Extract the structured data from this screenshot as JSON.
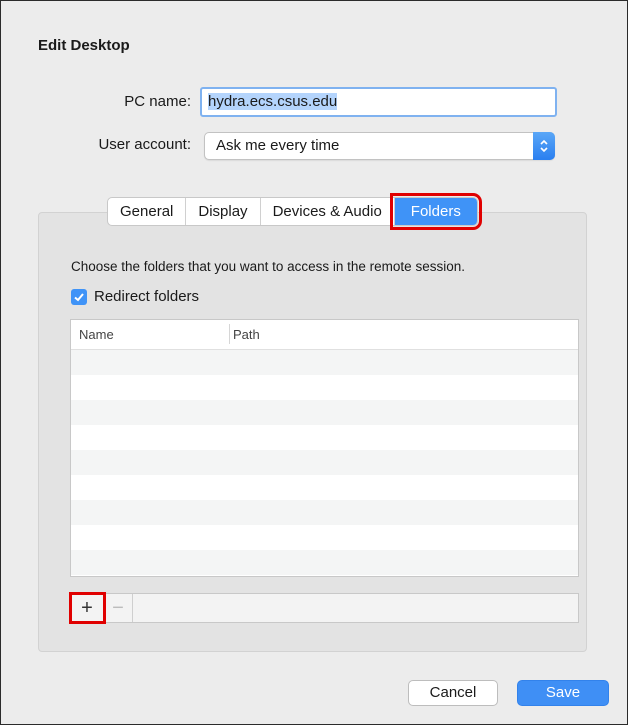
{
  "dialog": {
    "title": "Edit Desktop",
    "pc_name_label": "PC name:",
    "pc_name_value": "hydra.ecs.csus.edu",
    "user_account_label": "User account:",
    "user_account_value": "Ask me every time"
  },
  "tabs": [
    {
      "label": "General"
    },
    {
      "label": "Display"
    },
    {
      "label": "Devices & Audio"
    },
    {
      "label": "Folders",
      "active": true
    }
  ],
  "folders": {
    "description": "Choose the folders that you want to access in the remote session.",
    "redirect_label": "Redirect folders",
    "redirect_checked": true,
    "columns": [
      "Name",
      "Path"
    ],
    "rows": [],
    "add_symbol": "+",
    "remove_symbol": "−"
  },
  "buttons": {
    "cancel": "Cancel",
    "save": "Save"
  },
  "colors": {
    "accent": "#3f93f7",
    "highlight": "#e00000"
  },
  "icons": {
    "checkbox": "checkmark-icon",
    "popup": "up-down-chevron-icon"
  }
}
